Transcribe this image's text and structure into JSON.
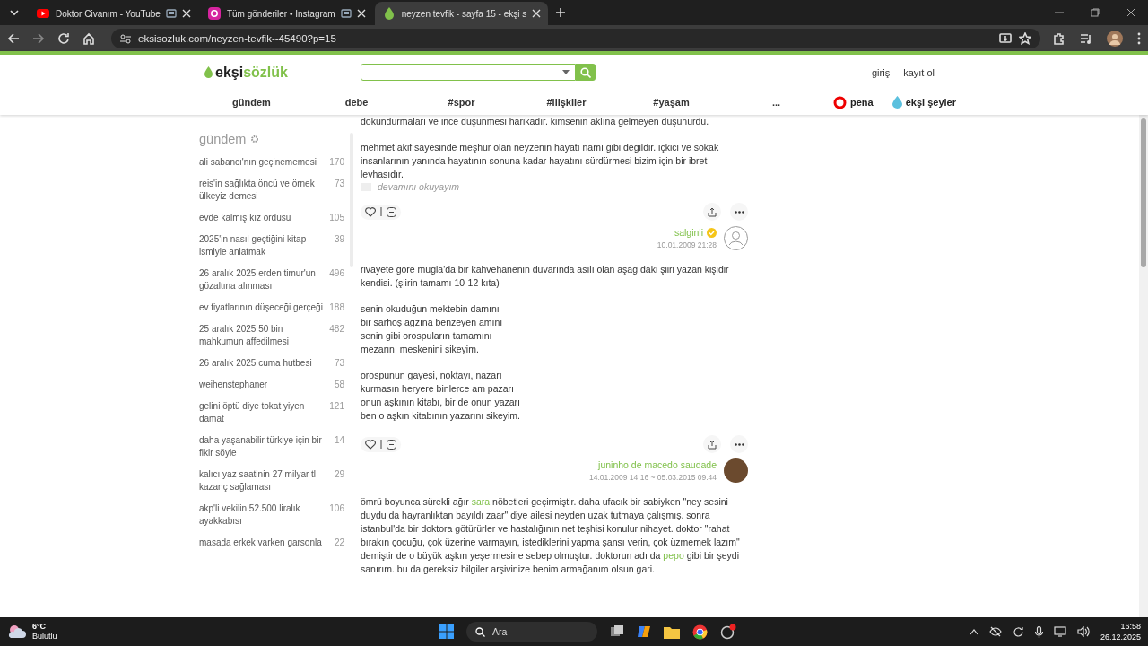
{
  "browser": {
    "tabs": [
      {
        "title": "Doktor Civanım - YouTube",
        "kind": "video",
        "selected": false
      },
      {
        "title": "Tüm gönderiler • Instagram",
        "kind": "photos",
        "selected": false
      },
      {
        "title": "neyzen tevfik - sayfa 15 - ekşi s",
        "kind": "site",
        "selected": true
      }
    ],
    "url": "eksisozluk.com/neyzen-tevfik--45490?p=15"
  },
  "header": {
    "logo": [
      "ekşi",
      "sözlük"
    ],
    "auth_links": [
      "giriş",
      "kayıt ol"
    ],
    "nav": [
      "gündem",
      "debe",
      "#spor",
      "#ilişkiler",
      "#yaşam",
      "..."
    ],
    "partners": [
      {
        "kind": "pena",
        "label": "pena"
      },
      {
        "kind": "seyler",
        "label": "ekşi şeyler"
      }
    ]
  },
  "sidebar": {
    "title": "gündem",
    "topics": [
      {
        "title": "ali sabancı'nın geçinememesi",
        "count": "170"
      },
      {
        "title": "reis'in sağlıkta öncü ve örnek ülkeyiz demesi",
        "count": "73"
      },
      {
        "title": "evde kalmış kız ordusu",
        "count": "105"
      },
      {
        "title": "2025'in nasıl geçtiğini kitap ismiyle anlatmak",
        "count": "39"
      },
      {
        "title": "26 aralık 2025 erden timur'un gözaltına alınması",
        "count": "496"
      },
      {
        "title": "ev fiyatlarının düşeceği gerçeği",
        "count": "188"
      },
      {
        "title": "25 aralık 2025 50 bin mahkumun affedilmesi",
        "count": "482"
      },
      {
        "title": "26 aralık 2025 cuma hutbesi",
        "count": "73"
      },
      {
        "title": "weihenstephaner",
        "count": "58"
      },
      {
        "title": "gelini öptü diye tokat yiyen damat",
        "count": "121"
      },
      {
        "title": "daha yaşanabilir türkiye için bir fikir söyle",
        "count": "14"
      },
      {
        "title": "kalıcı yaz saatinin 27 milyar tl kazanç sağlaması",
        "count": "29"
      },
      {
        "title": "akp'li vekilin 52.500 liralık ayakkabısı",
        "count": "106"
      },
      {
        "title": "masada erkek varken garsonla",
        "count": "22"
      }
    ]
  },
  "entries": [
    {
      "paragraphs": [
        [
          {
            "kind": "text",
            "text": "dokundurmaları ve ince düşünmesi harikadır. kimsenin aklına gelmeyen düşünürdü."
          }
        ],
        [
          {
            "kind": "text",
            "text": "mehmet akif sayesinde meşhur olan neyzenin hayatı namı gibi değildir. içkici ve sokak insanlarının yanında hayatının sonuna kadar hayatını sürdürmesi bizim için bir ibret levhasıdır."
          }
        ]
      ],
      "read_more": "devamını okuyayım",
      "author": "salginli",
      "verified": true,
      "date": "10.01.2009 21:28",
      "avatar": {
        "kind": "placeholder"
      }
    },
    {
      "paragraphs": [
        [
          {
            "kind": "text",
            "text": "rivayete göre muğla'da bir kahvehanenin duvarında asılı olan aşağıdaki şiiri yazan kişidir kendisi. (şiirin tamamı 10-12 kıta)"
          }
        ],
        [
          {
            "kind": "text",
            "text": "senin okuduğun mektebin damını\nbir sarhoş ağzına benzeyen amını\nsenin gibi orospuların tamamını\nmezarını meskenini sikeyim."
          }
        ],
        [
          {
            "kind": "text",
            "text": "orospunun gayesi, noktayı, nazarı\nkurmasın heryere binlerce am pazarı\nonun aşkının kitabı, bir de onun yazarı\nben o aşkın kitabının yazarını sikeyim."
          }
        ]
      ],
      "author": "juninho de macedo saudade",
      "verified": false,
      "date": "14.01.2009 14:16 ~ 05.03.2015 09:44",
      "avatar": {
        "kind": "photo"
      }
    },
    {
      "paragraphs": [
        [
          {
            "kind": "text",
            "text": "ömrü boyunca sürekli ağır "
          },
          {
            "kind": "link",
            "text": "sara"
          },
          {
            "kind": "text",
            "text": " nöbetleri geçirmiştir. daha ufacık bir sabiyken \"ney sesini duydu da hayranlıktan bayıldı zaar\" diye ailesi neyden uzak tutmaya çalışmış. sonra istanbul'da bir doktora götürürler ve hastalığının net teşhisi konulur nihayet. doktor \"rahat bırakın çocuğu, çok üzerine varmayın, istediklerini yapma şansı verin, çok üzmemek lazım\" demiştir de o büyük aşkın yeşermesine sebep olmuştur. doktorun adı da "
          },
          {
            "kind": "link",
            "text": "pepo"
          },
          {
            "kind": "text",
            "text": " gibi bir şeydi sanırım. bu da gereksiz bilgiler arşivinize benim armağanım olsun gari."
          }
        ]
      ]
    }
  ],
  "taskbar": {
    "weather": {
      "temp": "6°C",
      "condition": "Bulutlu"
    },
    "search_placeholder": "Ara",
    "time": "16:58",
    "date": "26.12.2025"
  }
}
